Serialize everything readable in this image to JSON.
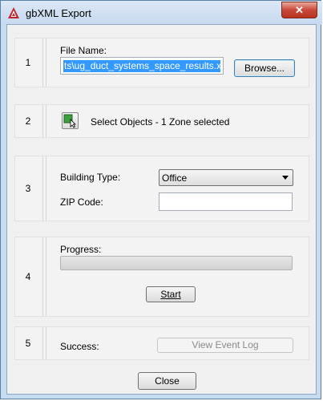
{
  "window": {
    "title": "gbXML Export",
    "close_glyph": "✕"
  },
  "section1": {
    "number": "1",
    "file_name_label": "File Name:",
    "file_name_value": "ts\\ug_duct_systems_space_results.xml",
    "browse_label": "Browse..."
  },
  "section2": {
    "number": "2",
    "select_objects_label": "Select Objects - 1 Zone selected",
    "icon": "select-objects-icon"
  },
  "section3": {
    "number": "3",
    "building_type_label": "Building Type:",
    "building_type_value": "Office",
    "zip_code_label": "ZIP Code:",
    "zip_code_value": ""
  },
  "section4": {
    "number": "4",
    "progress_label": "Progress:",
    "progress_value": 0,
    "start_label": "Start"
  },
  "section5": {
    "number": "5",
    "status_label": "Success:",
    "view_log_label": "View Event Log"
  },
  "footer": {
    "close_label": "Close"
  },
  "colors": {
    "titlebar": "#c6d9ef",
    "selection": "#3399ff",
    "close_button": "#c8483a"
  }
}
